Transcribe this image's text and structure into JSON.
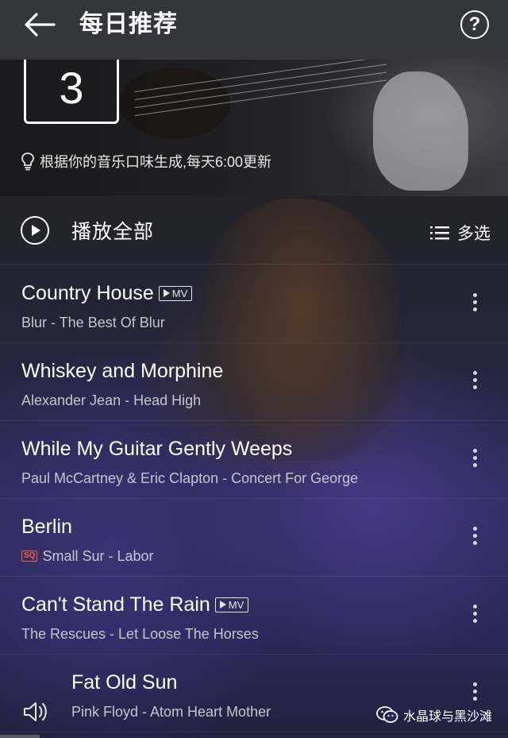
{
  "header": {
    "title": "每日推荐",
    "back_icon": "back-arrow-icon",
    "help_icon": "help-icon"
  },
  "banner": {
    "date": "3",
    "hint_icon": "lightbulb-icon",
    "hint": "根据你的音乐口味生成,每天6:00更新"
  },
  "actions": {
    "play_all_label": "播放全部",
    "play_icon": "play-circle-icon",
    "multi_select_label": "多选",
    "multi_select_icon": "list-icon"
  },
  "songs": [
    {
      "title": "Country House",
      "subtitle": "Blur - The Best Of Blur",
      "mv": true,
      "mv_label": "MV"
    },
    {
      "title": "Whiskey and Morphine",
      "subtitle": "Alexander Jean - Head High"
    },
    {
      "title": "While My Guitar Gently Weeps",
      "subtitle": "Paul McCartney & Eric Clapton - Concert For George"
    },
    {
      "title": "Berlin",
      "subtitle": "Small Sur - Labor",
      "badge": "SQ"
    },
    {
      "title": "Can't Stand The Rain",
      "subtitle": "The Rescues - Let Loose The Horses",
      "mv": true,
      "mv_label": "MV"
    },
    {
      "title": "Fat Old Sun",
      "subtitle": "Pink Floyd - Atom Heart Mother",
      "playing": true
    }
  ],
  "watermark": {
    "text": "水晶球与黑沙滩",
    "icon": "wechat-icon"
  },
  "colors": {
    "topbar": "#35363b",
    "sq_badge": "#ff5a3c",
    "subtitle_text": "#c5c5d2"
  }
}
